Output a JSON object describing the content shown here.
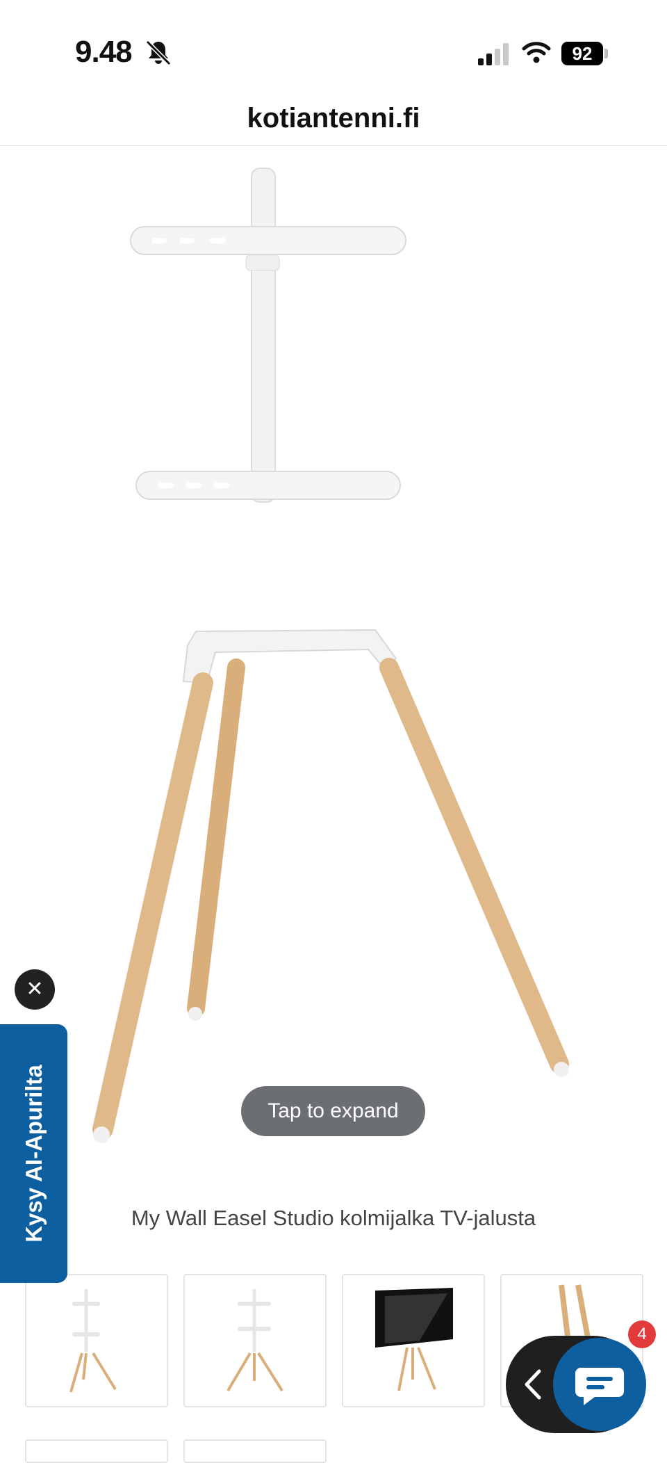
{
  "status_bar": {
    "time": "9.48",
    "battery": "92"
  },
  "browser": {
    "url": "kotiantenni.fi"
  },
  "gallery": {
    "tap_hint": "Tap to expand",
    "caption": "My Wall Easel Studio kolmijalka TV-jalusta",
    "thumbnails": [
      "stand-front",
      "stand-angle",
      "stand-with-tv",
      "stand-detail"
    ]
  },
  "ai_assistant": {
    "tab_label": "Kysy AI-Apurilta",
    "close_icon": "close-icon"
  },
  "chat_widget": {
    "unread_count": "4",
    "icon": "chat-bubble-icon"
  },
  "colors": {
    "accent_blue": "#0d5fa0",
    "badge_red": "#e23b3b",
    "pill_gray": "#6b6e72",
    "wood": "#e0b98a"
  }
}
